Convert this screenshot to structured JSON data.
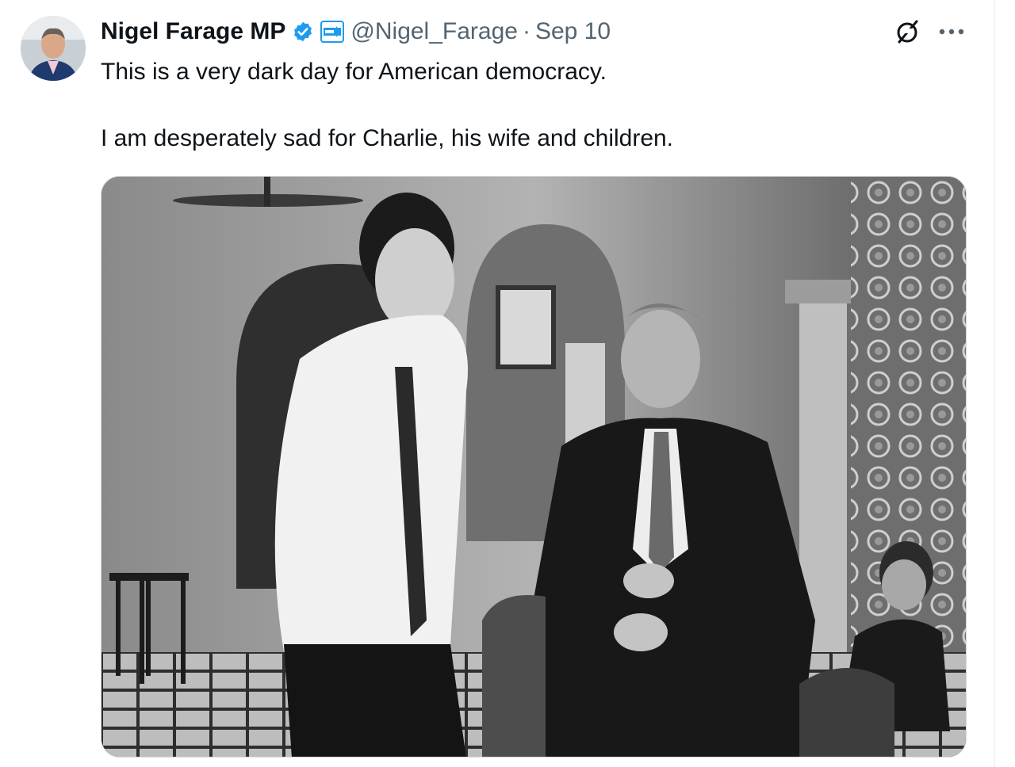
{
  "tweet": {
    "author": {
      "display_name": "Nigel Farage MP",
      "handle": "@Nigel_Farage",
      "verified_badge": "verified-badge-icon",
      "affiliate_badge": "affiliate-badge-icon"
    },
    "separator": "·",
    "date": "Sep 10",
    "text_paragraphs": [
      "This is a very dark day for American democracy.",
      "I am desperately sad for Charlie, his wife and children."
    ],
    "media": {
      "type": "photo",
      "style": "black-and-white"
    },
    "actions": {
      "grok_icon": "grok-icon",
      "more_icon": "more-dots-icon"
    }
  },
  "colors": {
    "text_primary": "#0f1419",
    "text_secondary": "#536471",
    "verified_blue": "#1d9bf0",
    "affiliate_teal": "#1d9bf0",
    "border": "#cfd9de"
  }
}
